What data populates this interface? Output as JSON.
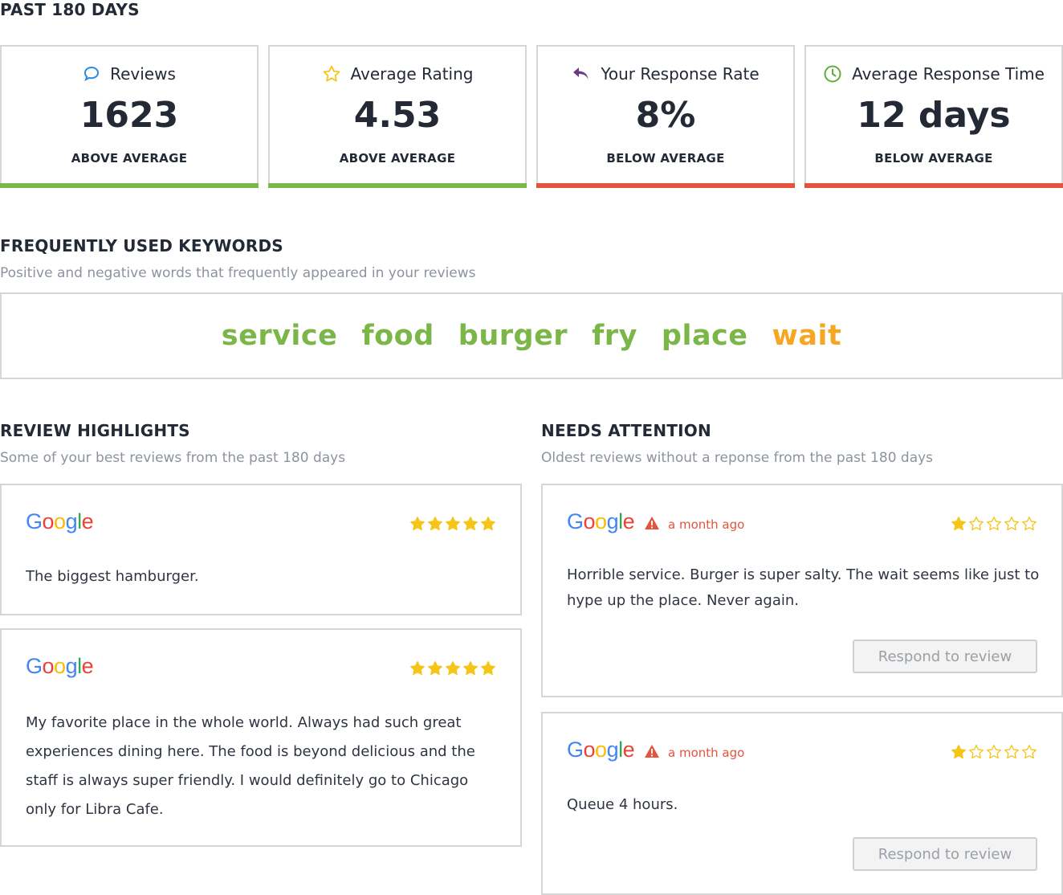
{
  "period_title": "PAST 180 DAYS",
  "stats": [
    {
      "label": "Reviews",
      "value": "1623",
      "status": "ABOVE AVERAGE",
      "icon": "speech-bubble-icon",
      "bar_color": "#7ab648"
    },
    {
      "label": "Average Rating",
      "value": "4.53",
      "status": "ABOVE AVERAGE",
      "icon": "star-outline-icon",
      "bar_color": "#7ab648"
    },
    {
      "label": "Your Response Rate",
      "value": "8%",
      "status": "BELOW AVERAGE",
      "icon": "reply-arrow-icon",
      "bar_color": "#e5533d"
    },
    {
      "label": "Average Response Time",
      "value": "12 days",
      "status": "BELOW AVERAGE",
      "icon": "clock-icon",
      "bar_color": "#e5533d"
    }
  ],
  "keywords": {
    "title": "FREQUENTLY USED KEYWORDS",
    "subtitle": "Positive and negative words that frequently appeared in your reviews",
    "items": [
      {
        "word": "service",
        "sentiment": "positive"
      },
      {
        "word": "food",
        "sentiment": "positive"
      },
      {
        "word": "burger",
        "sentiment": "positive"
      },
      {
        "word": "fry",
        "sentiment": "positive"
      },
      {
        "word": "place",
        "sentiment": "positive"
      },
      {
        "word": "wait",
        "sentiment": "negative"
      }
    ],
    "colors": {
      "positive": "#7ab648",
      "negative": "#f5a623"
    }
  },
  "highlights": {
    "title": "REVIEW HIGHLIGHTS",
    "subtitle": "Some of your best reviews from the past 180 days",
    "reviews": [
      {
        "source": "Google",
        "rating": 5,
        "text": "The biggest hamburger."
      },
      {
        "source": "Google",
        "rating": 5,
        "text": "My favorite place in the whole world. Always had such great experiences dining here. The food is beyond delicious and the staff is always super friendly. I would definitely go to Chicago only for Libra Cafe."
      }
    ]
  },
  "attention": {
    "title": "NEEDS ATTENTION",
    "subtitle": "Oldest reviews without a reponse from the past 180 days",
    "reviews": [
      {
        "source": "Google",
        "age": "a month ago",
        "rating": 1,
        "text": "Horrible service. Burger is super salty. The wait seems like just to hype up the place. Never again.",
        "button": "Respond to review"
      },
      {
        "source": "Google",
        "age": "a month ago",
        "rating": 1,
        "text": "Queue 4 hours.",
        "button": "Respond to review"
      }
    ]
  },
  "colors": {
    "star": "#f5c518",
    "google_blue": "#4285f4",
    "google_red": "#ea4335",
    "google_yellow": "#fbbc05",
    "google_green": "#34a853"
  }
}
